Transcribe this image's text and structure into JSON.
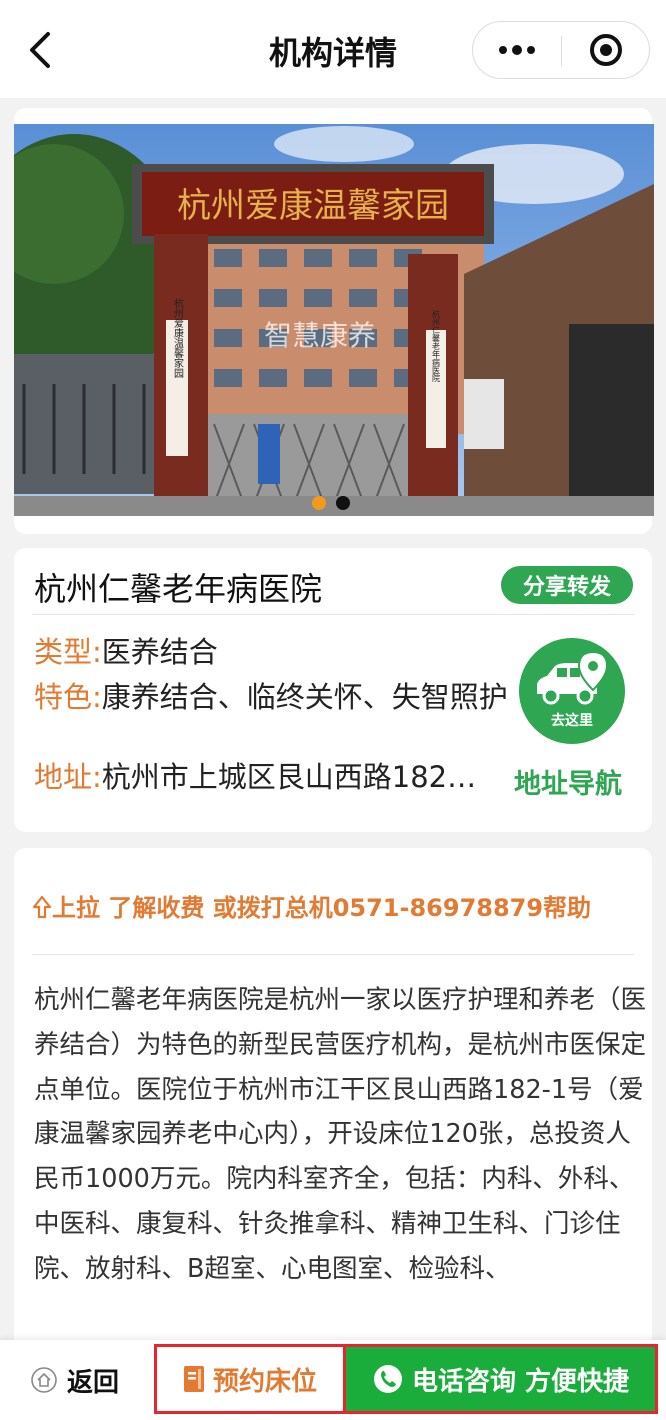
{
  "nav": {
    "title": "机构详情"
  },
  "photo": {
    "gate_sign": "杭州爱康温馨家园",
    "left_plaque": "杭州爱康温馨家园",
    "right_plaque": "杭州仁馨老年病医院",
    "watermark": "智慧康养",
    "slide_count": 2,
    "active_slide": 1
  },
  "info": {
    "name": "杭州仁馨老年病医院",
    "share_label": "分享转发",
    "type_key": "类型:",
    "type_value": "医养结合",
    "feature_key": "特色:",
    "feature_value": "康养结合、临终关怀、失智照护",
    "address_key": "地址:",
    "address_value": "杭州市上城区艮山西路182…",
    "goto_label": "去这里",
    "nav_link": "地址导航"
  },
  "description": {
    "hint": "上拉 了解收费 或拨打总机0571-86978879帮助",
    "text": "杭州仁馨老年病医院是杭州一家以医疗护理和养老（医养结合）为特色的新型民营医疗机构，是杭州市医保定点单位。医院位于杭州市江干区艮山西路182-1号（爱康温馨家园养老中心内），开设床位120张，总投资人民币1000万元。院内科室齐全，包括：内科、外科、中医科、康复科、针灸推拿科、精神卫生科、门诊住院、放射科、B超室、心电图室、检验科、"
  },
  "bottom": {
    "back_label": "返回",
    "reserve_label": "预约床位",
    "call_label": "电话咨询 方便快捷"
  },
  "colors": {
    "accent_green": "#2ea652",
    "label_orange": "#e27a32",
    "highlight_red": "#e8242f",
    "call_green": "#1aad3c"
  },
  "icons": [
    "back-arrow-icon",
    "more-icon",
    "close-target-icon",
    "car-location-icon",
    "up-arrow-icon",
    "home-icon",
    "document-icon",
    "phone-icon"
  ]
}
